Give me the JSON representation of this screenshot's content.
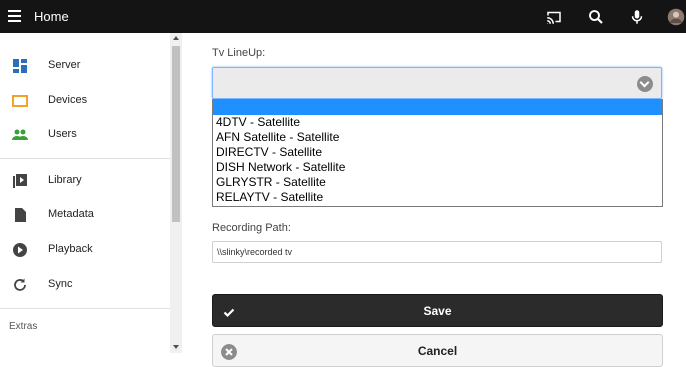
{
  "header": {
    "title": "Home",
    "icons": [
      "menu-icon",
      "cast-icon",
      "search-icon",
      "microphone-icon",
      "user-avatar"
    ]
  },
  "sidebar": {
    "items": [
      {
        "label": "Server",
        "icon": "dashboard-icon",
        "color": "#2a6fba"
      },
      {
        "label": "Devices",
        "icon": "device-icon",
        "color": "#f0a32b"
      },
      {
        "label": "Users",
        "icon": "users-icon",
        "color": "#3a9f3a"
      },
      {
        "label": "Library",
        "icon": "library-icon",
        "color": "#444444"
      },
      {
        "label": "Metadata",
        "icon": "metadata-icon",
        "color": "#444444"
      },
      {
        "label": "Playback",
        "icon": "playback-icon",
        "color": "#444444"
      },
      {
        "label": "Sync",
        "icon": "sync-icon",
        "color": "#444444"
      }
    ],
    "extras_label": "Extras"
  },
  "form": {
    "lineup_label": "Tv LineUp:",
    "lineup_selected": "",
    "lineup_options": [
      "",
      "4DTV - Satellite",
      "AFN Satellite - Satellite",
      "DIRECTV - Satellite",
      "DISH Network - Satellite",
      "GLRYSTR - Satellite",
      "RELAYTV - Satellite"
    ],
    "recording_path_label": "Recording Path:",
    "recording_path_value": "\\\\slinky\\recorded tv",
    "save_label": "Save",
    "cancel_label": "Cancel"
  },
  "colors": {
    "topbar": "#141414",
    "highlight": "#1e90ff",
    "save_button": "#2b2b2b"
  }
}
